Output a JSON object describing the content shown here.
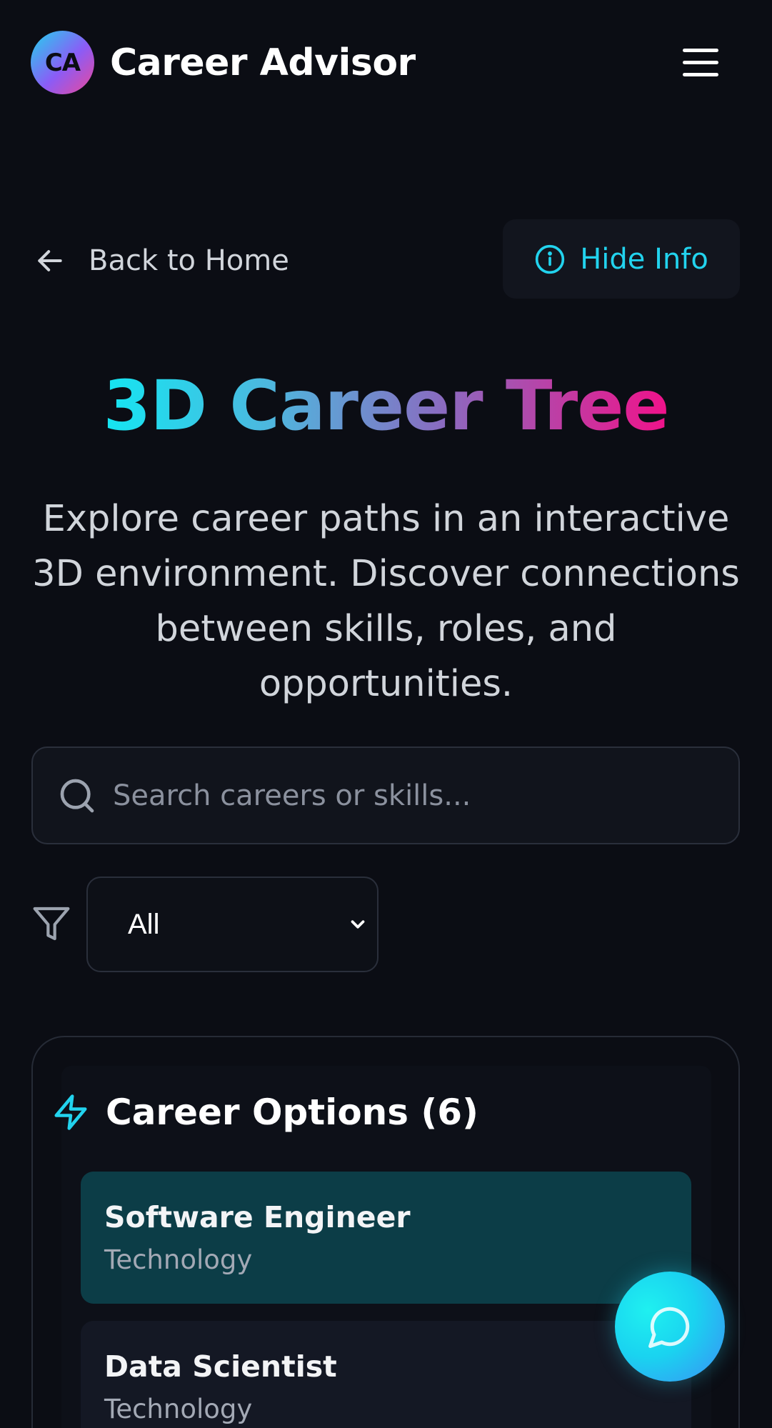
{
  "header": {
    "logo_initials": "CA",
    "brand": "Career Advisor",
    "menu_icon": "hamburger-menu-icon"
  },
  "nav": {
    "back_label": "Back to Home",
    "back_icon": "arrow-left-icon",
    "hide_info_label": "Hide Info",
    "hide_info_icon": "info-circle-icon"
  },
  "hero": {
    "title": "3D Career Tree",
    "subtitle": "Explore career paths in an interactive 3D environment. Discover connections between skills, roles, and opportunities."
  },
  "search": {
    "placeholder": "Search careers or skills...",
    "value": "",
    "icon": "search-icon"
  },
  "filter": {
    "icon": "filter-icon",
    "selected": "All"
  },
  "careers": {
    "heading": "Career Options (6)",
    "heading_icon": "lightning-bolt-icon",
    "items": [
      {
        "name": "Software Engineer",
        "category": "Technology",
        "selected": true
      },
      {
        "name": "Data Scientist",
        "category": "Technology",
        "selected": false
      }
    ]
  },
  "chat": {
    "icon": "chat-bubble-icon"
  },
  "colors": {
    "background": "#0b0d14",
    "accent": "#22d3ee",
    "accent_pink": "#ec4899",
    "selected_card": "#0c3d47"
  }
}
